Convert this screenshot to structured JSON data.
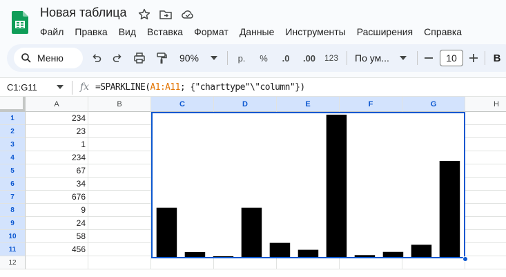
{
  "app": {
    "title": "Новая таблица",
    "icons": [
      "sheets-logo-icon",
      "star-icon",
      "move-to-folder-icon",
      "cloud-saved-icon"
    ]
  },
  "menu": [
    "Файл",
    "Правка",
    "Вид",
    "Вставка",
    "Формат",
    "Данные",
    "Инструменты",
    "Расширения",
    "Справка"
  ],
  "toolbar": {
    "search_label": "Меню",
    "zoom": "90%",
    "currency": "р.",
    "percent": "%",
    "decrease_decimal": ".0",
    "increase_decimal": ".00",
    "number_format": "123",
    "font": "По ум...",
    "font_size": "10",
    "bold": "B"
  },
  "formula_bar": {
    "name_box": "C1:G11",
    "fx": "fx",
    "formula_prefix": "=SPARKLINE(",
    "formula_ref": "A1:A11",
    "formula_suffix": "; {\"charttype\"\\\"column\"})"
  },
  "grid": {
    "columns": [
      "A",
      "B",
      "C",
      "D",
      "E",
      "F",
      "G",
      "H"
    ],
    "selected_columns": [
      "C",
      "D",
      "E",
      "F",
      "G"
    ],
    "rows": [
      "1",
      "2",
      "3",
      "4",
      "5",
      "6",
      "7",
      "8",
      "9",
      "10",
      "11",
      "12"
    ],
    "selected_rows": [
      "1",
      "2",
      "3",
      "4",
      "5",
      "6",
      "7",
      "8",
      "9",
      "10",
      "11"
    ],
    "column_a_values": [
      "234",
      "23",
      "1",
      "234",
      "67",
      "34",
      "676",
      "9",
      "24",
      "58",
      "456"
    ]
  },
  "chart_data": {
    "type": "bar",
    "categories": [
      "A1",
      "A2",
      "A3",
      "A4",
      "A5",
      "A6",
      "A7",
      "A8",
      "A9",
      "A10",
      "A11"
    ],
    "values": [
      234,
      23,
      1,
      234,
      67,
      34,
      676,
      9,
      24,
      58,
      456
    ],
    "ylim": [
      0,
      676
    ],
    "bar_color": "#000000",
    "selection_color": "#0b57d0"
  }
}
